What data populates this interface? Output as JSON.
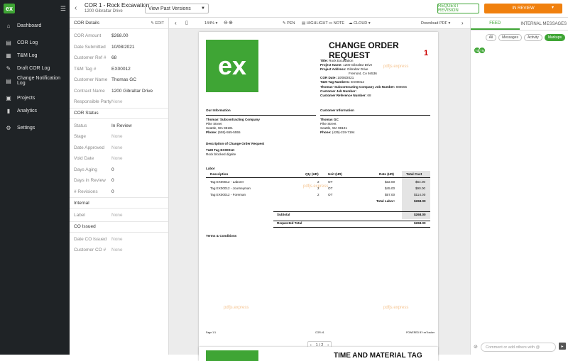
{
  "app": {
    "logo_text": "ex",
    "accent": "#3fa535",
    "orange": "#f0800e"
  },
  "sidebar": {
    "items": [
      {
        "label": "Dashboard",
        "icon": "home-icon"
      },
      {
        "label": "COR Log",
        "icon": "document-icon"
      },
      {
        "label": "T&M Log",
        "icon": "list-icon"
      },
      {
        "label": "Draft COR Log",
        "icon": "pencil-icon"
      },
      {
        "label": "Change Notification Log",
        "icon": "document-icon"
      },
      {
        "label": "Projects",
        "icon": "briefcase-icon"
      },
      {
        "label": "Analytics",
        "icon": "chart-icon"
      },
      {
        "label": "Settings",
        "icon": "gear-icon"
      }
    ]
  },
  "header": {
    "title": "COR 1 - Rock Excavation",
    "subtitle": "1200 Gibraltar Drive",
    "versions_select": "View Past Versions",
    "request_revision": "REQUEST REVISION",
    "status_button": "IN REVIEW"
  },
  "details": {
    "cor_details_title": "COR Details",
    "edit_label": "EDIT",
    "cor_details": [
      {
        "label": "COR Amount",
        "value": "$268.00"
      },
      {
        "label": "Date Submitted",
        "value": "10/08/2021"
      },
      {
        "label": "Customer Ref #",
        "value": "68"
      },
      {
        "label": "T&M Tag #",
        "value": "EX00012"
      },
      {
        "label": "Customer Name",
        "value": "Thomas GC"
      },
      {
        "label": "Contract Name",
        "value": "1200 Gibraltar Drive"
      },
      {
        "label": "Responsible Party",
        "value": "None"
      }
    ],
    "cor_status_title": "COR Status",
    "cor_status": [
      {
        "label": "Status",
        "value": "In Review"
      },
      {
        "label": "Stage",
        "value": "None"
      },
      {
        "label": "Date Approved",
        "value": "None"
      },
      {
        "label": "Void Date",
        "value": "None"
      },
      {
        "label": "Days Aging",
        "value": "0"
      },
      {
        "label": "Days in Review",
        "value": "0"
      },
      {
        "label": "# Revisions",
        "value": "0"
      }
    ],
    "internal_title": "Internal",
    "internal": [
      {
        "label": "Label",
        "value": "None"
      }
    ],
    "co_issued_title": "CO Issued",
    "co_issued": [
      {
        "label": "Date CO Issued",
        "value": "None"
      },
      {
        "label": "Customer CO #",
        "value": "None"
      }
    ]
  },
  "viewer": {
    "zoom": "144%",
    "pen": "PEN",
    "highlight": "HIGHLIGHT",
    "note": "NOTE",
    "cloud": "CLOUD",
    "download": "Download PDF",
    "page_indicator": "1 / 2",
    "page2_title": "TIME AND MATERIAL TAG"
  },
  "doc": {
    "title": "CHANGE ORDER REQUEST",
    "number": "1",
    "logo": "ex",
    "watermark": "pdfjs.express",
    "title_label": "Title:",
    "title_value": "Rock Excavation",
    "project_name_label": "Project Name:",
    "project_name_value": "1200 Gibraltar Drive",
    "project_address_label": "Project Address:",
    "project_address_value": "Gibraltar Drive",
    "address_line2": "Fremont, CA 94536",
    "cor_date_label": "COR Date:",
    "cor_date_value": "10/08/2021",
    "tm_tag_label": "T&M Tag Numbers:",
    "tm_tag_value": "EX00012",
    "sub_job_label": "Thomas' Subcontracting Company Job Number:",
    "sub_job_value": "888555",
    "customer_job_label": "Customer Job Number:",
    "customer_ref_label": "Customer Reference Number:",
    "customer_ref_value": "68",
    "our_info": "Our Information",
    "customer_info": "Customer Information",
    "our_company": "Thomas' Subcontracting Company",
    "our_street": "Pike Street",
    "our_city": "Seattle, WA 98101",
    "our_phone_label": "Phone:",
    "our_phone": "(555)-555-5555",
    "cust_company": "Thomas GC",
    "cust_street": "Pike Street",
    "cust_city": "Seattle, WA 98101",
    "cust_phone_label": "Phone:",
    "cust_phone": "(425)-219-7194",
    "desc_title": "Description of Change Order Request",
    "tag_title": "T&M Tag EX00012:",
    "tag_desc": "Rock blocked digsite",
    "labor": "Labor",
    "cols": [
      "Description",
      "Qty (HR)",
      "Unit (HR)",
      "Rate (HR)",
      "Total Cost"
    ],
    "rows": [
      [
        "Tag EX00012 - Laborer",
        "2",
        "OT",
        "$32.00",
        "$64.00"
      ],
      [
        "Tag EX00012 - Journeyman",
        "2",
        "OT",
        "$45.00",
        "$90.00"
      ],
      [
        "Tag EX00012 - Foreman",
        "2",
        "OT",
        "$57.00",
        "$114.00"
      ]
    ],
    "total_labor_label": "Total Labor:",
    "total_labor": "$268.00",
    "subtotal_label": "Subtotal",
    "subtotal": "$268.00",
    "requested_label": "Requested Total",
    "requested": "$268.00",
    "terms": "Terms & Conditions",
    "footer_left": "Page 1/1",
    "footer_mid": "COR #1",
    "footer_right": "POWERED BY exTracker"
  },
  "feed": {
    "tab_feed": "FEED",
    "tab_internal": "INTERNAL MESSAGES",
    "filters": [
      "All",
      "Messages",
      "Activity",
      "Markups"
    ],
    "avatars": [
      "TG",
      "TN"
    ],
    "comment_placeholder": "Comment or add others with @"
  }
}
